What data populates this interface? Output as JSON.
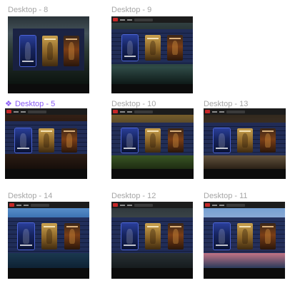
{
  "frames": [
    {
      "id": "d8",
      "label": "Desktop - 8",
      "component": false,
      "background": "mountain-forest",
      "bg_colors": [
        "#2a3338",
        "#44535a",
        "#2c3a34",
        "#1a2420",
        "#0c1410"
      ]
    },
    {
      "id": "d9",
      "label": "Desktop - 9",
      "component": false,
      "background": "lake-reflection",
      "bg_colors": [
        "#3a4a4a",
        "#243032",
        "#1a2826",
        "#2f4a46",
        "#0e1a18"
      ]
    },
    {
      "id": "d5",
      "label": "Desktop - 5",
      "component": true,
      "component_glyph": "❖",
      "background": "street-night",
      "bg_colors": [
        "#3b2416",
        "#2a1a12",
        "#4a2e1c",
        "#2c1d14",
        "#160e0a"
      ]
    },
    {
      "id": "d10",
      "label": "Desktop - 10",
      "component": false,
      "background": "sunset-field",
      "bg_colors": [
        "#8a6a2a",
        "#5a4a2a",
        "#4a5630",
        "#3c5a26",
        "#1e2c12"
      ]
    },
    {
      "id": "d13",
      "label": "Desktop - 13",
      "component": false,
      "background": "forest-path",
      "bg_colors": [
        "#2c241a",
        "#3a2e22",
        "#2a2218",
        "#6a5a42",
        "#2a2016"
      ]
    },
    {
      "id": "d14",
      "label": "Desktop - 14",
      "component": false,
      "background": "cliff-coast",
      "bg_colors": [
        "#6aa0d8",
        "#3a70b0",
        "#2a4a6a",
        "#1c3a52",
        "#0e2234"
      ]
    },
    {
      "id": "d12",
      "label": "Desktop - 12",
      "component": false,
      "background": "frozen-river",
      "bg_colors": [
        "#2a3236",
        "#3a4448",
        "#5a6468",
        "#2a3236",
        "#161c1e"
      ]
    },
    {
      "id": "d11",
      "label": "Desktop - 11",
      "component": false,
      "background": "pink-sunset-sea",
      "bg_colors": [
        "#6a9ad0",
        "#8aaad6",
        "#4a6a9a",
        "#d27a8a",
        "#2a3a5a"
      ]
    }
  ],
  "navbar": {
    "logo_color": "#c62828",
    "bar_color": "#1c1c1c"
  },
  "panel_color": "#1c2548",
  "posters": [
    {
      "name": "blue-hero-poster",
      "style": "blue"
    },
    {
      "name": "golden-desert-poster",
      "style": "gold"
    },
    {
      "name": "fire-battle-poster",
      "style": "fire"
    }
  ]
}
